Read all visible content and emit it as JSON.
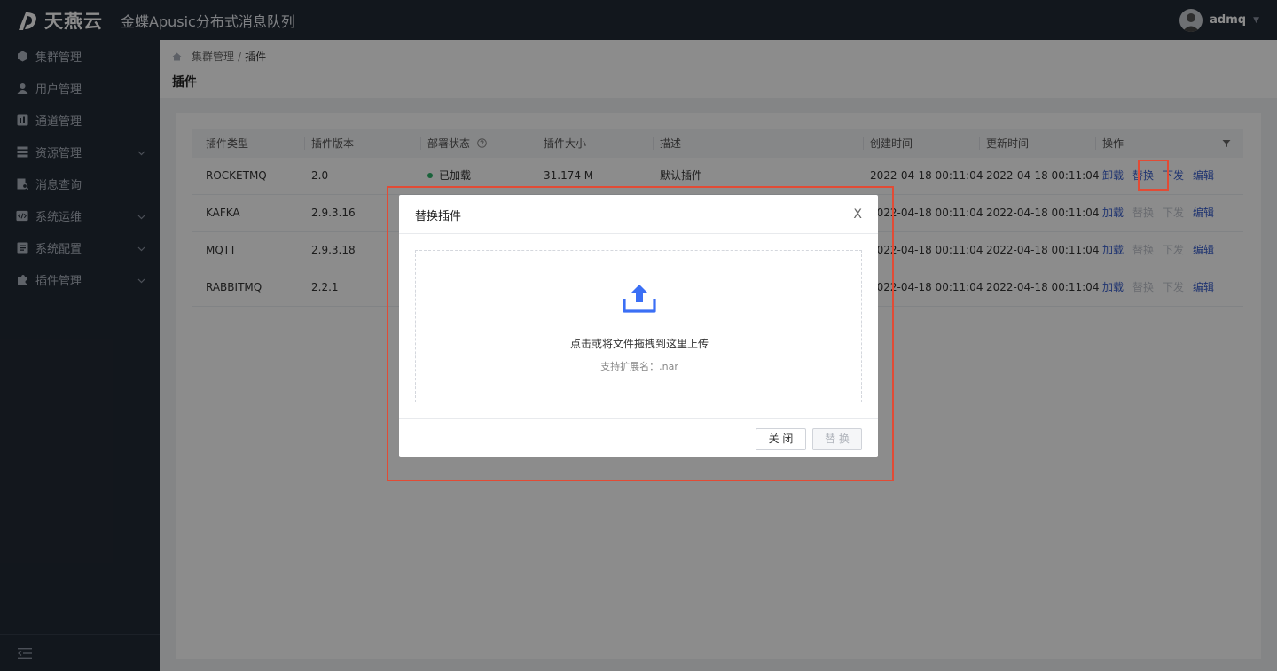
{
  "brand": {
    "logo_text": "天燕云",
    "product": "金蝶Apusic分布式消息队列"
  },
  "user": {
    "name": "admq"
  },
  "sidebar": {
    "items": [
      {
        "label": "集群管理",
        "icon": "cube-icon",
        "expandable": false
      },
      {
        "label": "用户管理",
        "icon": "user-icon",
        "expandable": false
      },
      {
        "label": "通道管理",
        "icon": "channel-icon",
        "expandable": false
      },
      {
        "label": "资源管理",
        "icon": "server-icon",
        "expandable": true
      },
      {
        "label": "消息查询",
        "icon": "message-search-icon",
        "expandable": false
      },
      {
        "label": "系统运维",
        "icon": "code-icon",
        "expandable": true
      },
      {
        "label": "系统配置",
        "icon": "config-icon",
        "expandable": true
      },
      {
        "label": "插件管理",
        "icon": "puzzle-icon",
        "expandable": true
      }
    ]
  },
  "breadcrumb": {
    "parent": "集群管理",
    "separator": "/",
    "current": "插件"
  },
  "page": {
    "title": "插件"
  },
  "table": {
    "columns": [
      "插件类型",
      "插件版本",
      "部署状态",
      "插件大小",
      "描述",
      "创建时间",
      "更新时间",
      "操作"
    ],
    "rows": [
      {
        "type": "ROCKETMQ",
        "version": "2.0",
        "status": "已加载",
        "size": "31.174 M",
        "desc": "默认插件",
        "created": "2022-04-18 00:11:04",
        "updated": "2022-04-18 00:11:04",
        "actions": [
          {
            "label": "卸载",
            "enabled": true
          },
          {
            "label": "替换",
            "enabled": true
          },
          {
            "label": "下发",
            "enabled": true
          },
          {
            "label": "编辑",
            "enabled": true
          }
        ]
      },
      {
        "type": "KAFKA",
        "version": "2.9.3.16",
        "status": "",
        "size": "",
        "desc": "",
        "created": "2022-04-18 00:11:04",
        "updated": "2022-04-18 00:11:04",
        "actions": [
          {
            "label": "加载",
            "enabled": true
          },
          {
            "label": "替换",
            "enabled": false
          },
          {
            "label": "下发",
            "enabled": false
          },
          {
            "label": "编辑",
            "enabled": true
          }
        ]
      },
      {
        "type": "MQTT",
        "version": "2.9.3.18",
        "status": "",
        "size": "",
        "desc": "",
        "created": "2022-04-18 00:11:04",
        "updated": "2022-04-18 00:11:04",
        "actions": [
          {
            "label": "加载",
            "enabled": true
          },
          {
            "label": "替换",
            "enabled": false
          },
          {
            "label": "下发",
            "enabled": false
          },
          {
            "label": "编辑",
            "enabled": true
          }
        ]
      },
      {
        "type": "RABBITMQ",
        "version": "2.2.1",
        "status": "",
        "size": "",
        "desc": "",
        "created": "2022-04-18 00:11:04",
        "updated": "2022-04-18 00:11:04",
        "actions": [
          {
            "label": "加载",
            "enabled": true
          },
          {
            "label": "替换",
            "enabled": false
          },
          {
            "label": "下发",
            "enabled": false
          },
          {
            "label": "编辑",
            "enabled": true
          }
        ]
      }
    ]
  },
  "modal": {
    "title": "替换插件",
    "close_symbol": "X",
    "drop_main": "点击或将文件拖拽到这里上传",
    "drop_sub": "支持扩展名：.nar",
    "btn_close": "关 闭",
    "btn_replace": "替 换"
  },
  "colors": {
    "topbar": "#222a35",
    "link": "#3a5fcd",
    "disabled": "#c0c4cc",
    "status_ok": "#2fb36a",
    "upload_icon": "#3b6ff5",
    "highlight": "#e24b35"
  }
}
